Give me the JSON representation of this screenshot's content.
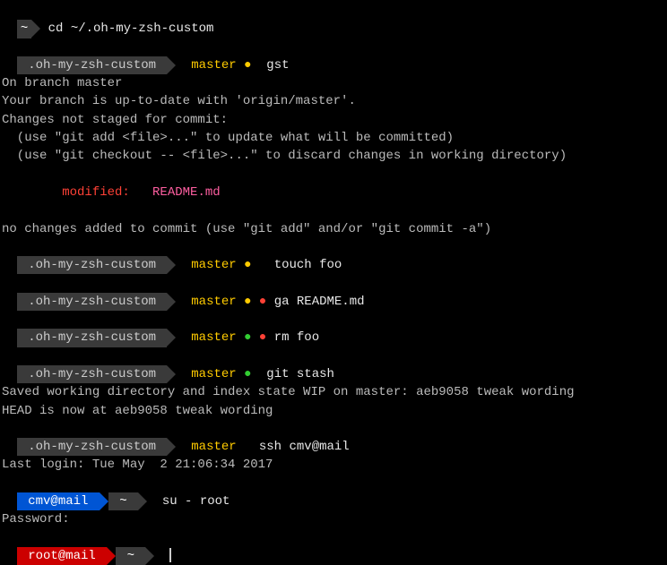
{
  "line1": {
    "tilde": "~",
    "cmd": " cd ~/.oh-my-zsh-custom"
  },
  "line2": {
    "dir": " .oh-my-zsh-custom ",
    "branch_icon": " ",
    "branch": " master ",
    "dot": "●",
    "cmd": "  gst"
  },
  "out1": "On branch master",
  "out2": "Your branch is up-to-date with 'origin/master'.",
  "out3": "Changes not staged for commit:",
  "out4": "  (use \"git add <file>...\" to update what will be committed)",
  "out5": "  (use \"git checkout -- <file>...\" to discard changes in working directory)",
  "out6_a": "        modified:   ",
  "out6_b": "README.md",
  "out7": "no changes added to commit (use \"git add\" and/or \"git commit -a\")",
  "line8": {
    "dir": " .oh-my-zsh-custom ",
    "branch_icon": " ",
    "branch": " master ",
    "dot1": "●",
    "cmd": "   touch foo"
  },
  "line9": {
    "dir": " .oh-my-zsh-custom ",
    "branch_icon": " ",
    "branch": " master ",
    "dot1": "●",
    "dot2": " ●",
    "cmd": " ga README.md"
  },
  "line10": {
    "dir": " .oh-my-zsh-custom ",
    "branch_icon": " ",
    "branch": " master ",
    "dot1": "●",
    "dot2": " ●",
    "cmd": " rm foo"
  },
  "line11": {
    "dir": " .oh-my-zsh-custom ",
    "branch_icon": " ",
    "branch": " master ",
    "dot1": "●",
    "cmd": "  git stash"
  },
  "out12": "Saved working directory and index state WIP on master: aeb9058 tweak wording",
  "out13": "HEAD is now at aeb9058 tweak wording",
  "line14": {
    "dir": " .oh-my-zsh-custom ",
    "branch_icon": " ",
    "branch": " master ",
    "cmd": "  ssh cmv@mail"
  },
  "out15": "Last login: Tue May  2 21:06:34 2017",
  "line16": {
    "host": " cmv@mail ",
    "tilde": "~",
    "cmd": "  su - root"
  },
  "out17": "Password:",
  "line18": {
    "host": " root@mail ",
    "tilde": "~",
    "cmd": "  "
  }
}
